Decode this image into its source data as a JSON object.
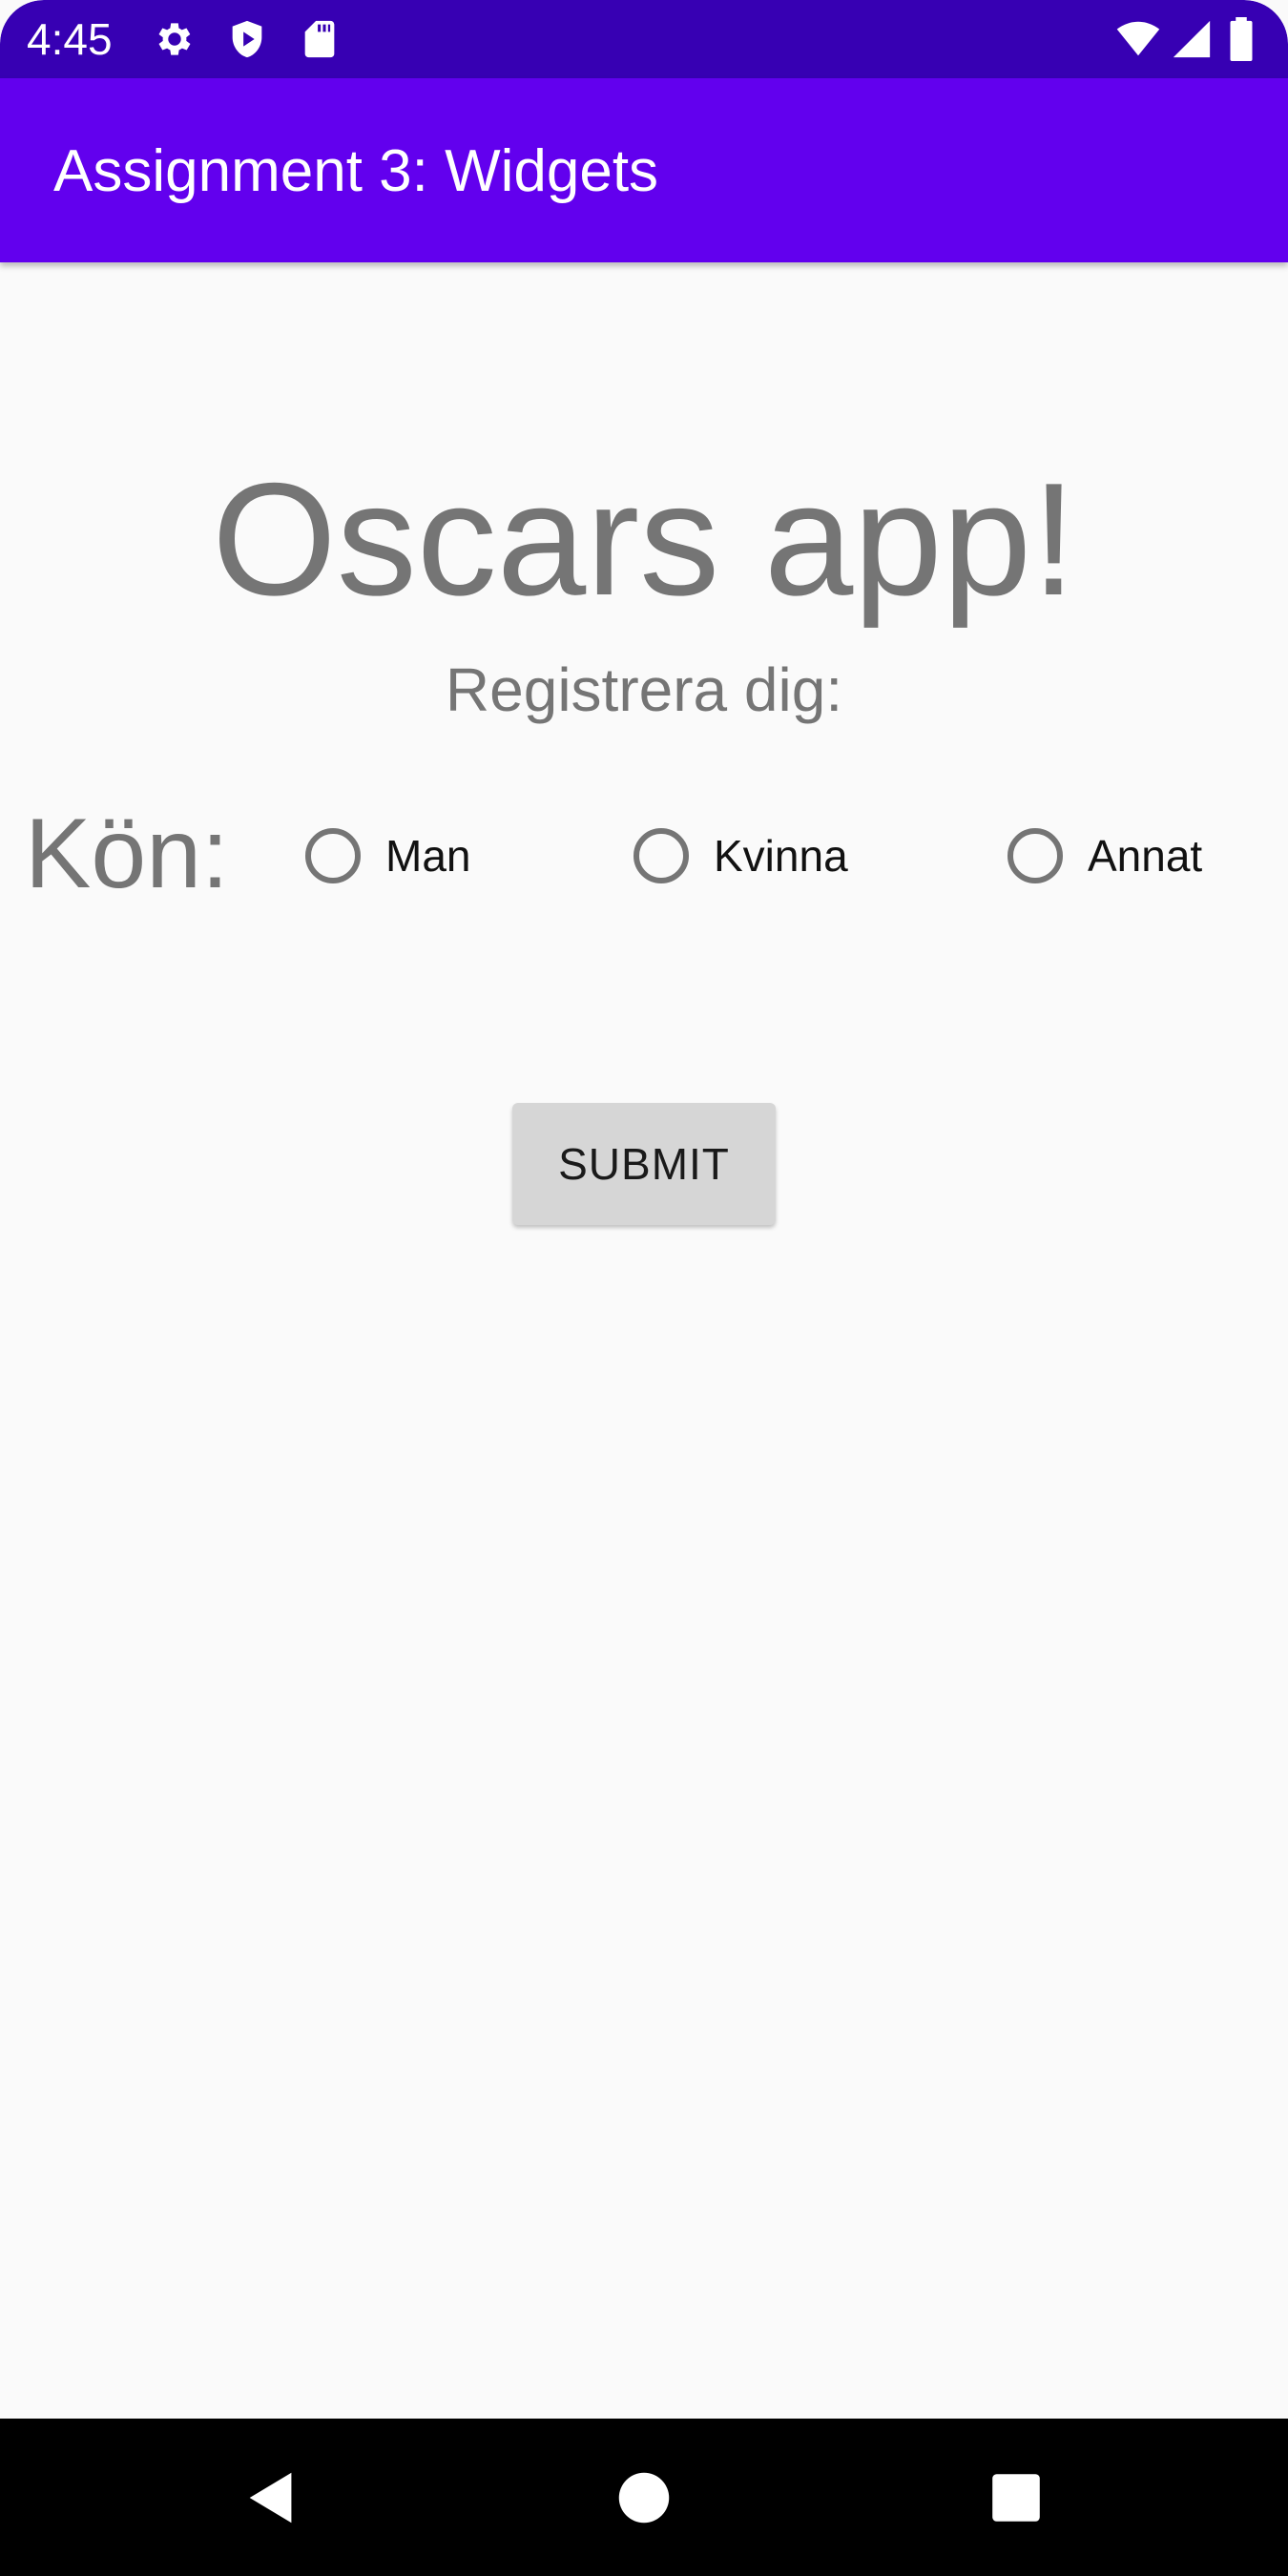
{
  "status_bar": {
    "time": "4:45",
    "left_icons": [
      "gear-icon",
      "shield-play-icon",
      "sd-card-icon"
    ],
    "right_icons": [
      "wifi-icon",
      "cell-signal-icon",
      "battery-icon"
    ],
    "background_color": "#3700b3"
  },
  "app_bar": {
    "title": "Assignment 3: Widgets",
    "background_color": "#6200ee"
  },
  "main": {
    "headline": "Oscars app!",
    "subheadline": "Registrera dig:",
    "gender_label": "Kön:",
    "gender_options": [
      {
        "label": "Man",
        "selected": false
      },
      {
        "label": "Kvinna",
        "selected": false
      },
      {
        "label": "Annat",
        "selected": false
      }
    ],
    "submit_label": "SUBMIT"
  },
  "nav_bar": {
    "buttons": [
      "back-icon",
      "home-icon",
      "recents-icon"
    ]
  }
}
